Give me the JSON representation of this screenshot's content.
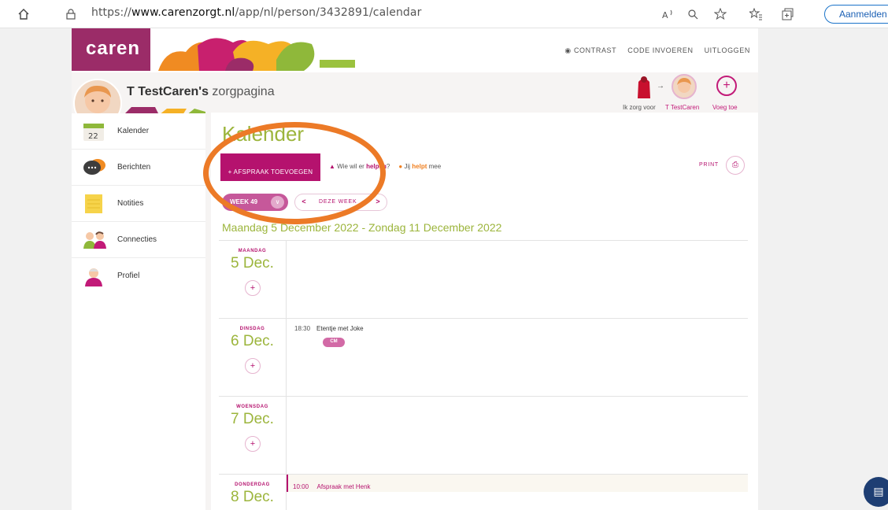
{
  "browser": {
    "url_prefix": "https://",
    "url_domain": "www.carenzorgt.nl",
    "url_path": "/app/nl/person/3432891/calendar",
    "signin_label": "Aanmelden"
  },
  "header": {
    "logo": "caren",
    "links": [
      "CONTRAST",
      "CODE INVOEREN",
      "UITLOGGEN"
    ]
  },
  "profile": {
    "name": "T TestCaren's",
    "page_suffix": " zorgpagina",
    "switcher": {
      "care_for": "Ik zorg voor",
      "current": "T TestCaren",
      "add": "Voeg toe"
    }
  },
  "sidebar": {
    "items": [
      {
        "label": "Kalender",
        "icon": "calendar-icon",
        "number": "22"
      },
      {
        "label": "Berichten",
        "icon": "message-icon"
      },
      {
        "label": "Notities",
        "icon": "notes-icon"
      },
      {
        "label": "Connecties",
        "icon": "people-icon"
      },
      {
        "label": "Profiel",
        "icon": "profile-icon"
      }
    ]
  },
  "main": {
    "title": "Kalender",
    "add_button": "+ AFSPRAAK TOEVOEGEN",
    "help_prefix": "Wie wil er",
    "help_highlight": "helpen",
    "help_suffix": "?",
    "jij_prefix": "Jij",
    "jij_highlight": "helpt",
    "jij_suffix": "mee",
    "print": "PRINT",
    "week": "WEEK 49",
    "this_week": "DEZE WEEK",
    "range": "Maandag 5 December 2022 - Zondag 11 December 2022",
    "days": [
      {
        "name": "MAANDAG",
        "date": "5 Dec."
      },
      {
        "name": "DINSDAG",
        "date": "6 Dec.",
        "event_time": "18:30",
        "event_title": "Etentje met Joke",
        "badge": "CM"
      },
      {
        "name": "WOENSDAG",
        "date": "7 Dec."
      },
      {
        "name": "DONDERDAG",
        "date": "8 Dec.",
        "event_time": "10:00",
        "event_title": "Afspraak met Henk"
      }
    ]
  },
  "colors": {
    "accent": "#b5126e",
    "green": "#9cb53c",
    "highlight_ring": "#ec7a27"
  }
}
